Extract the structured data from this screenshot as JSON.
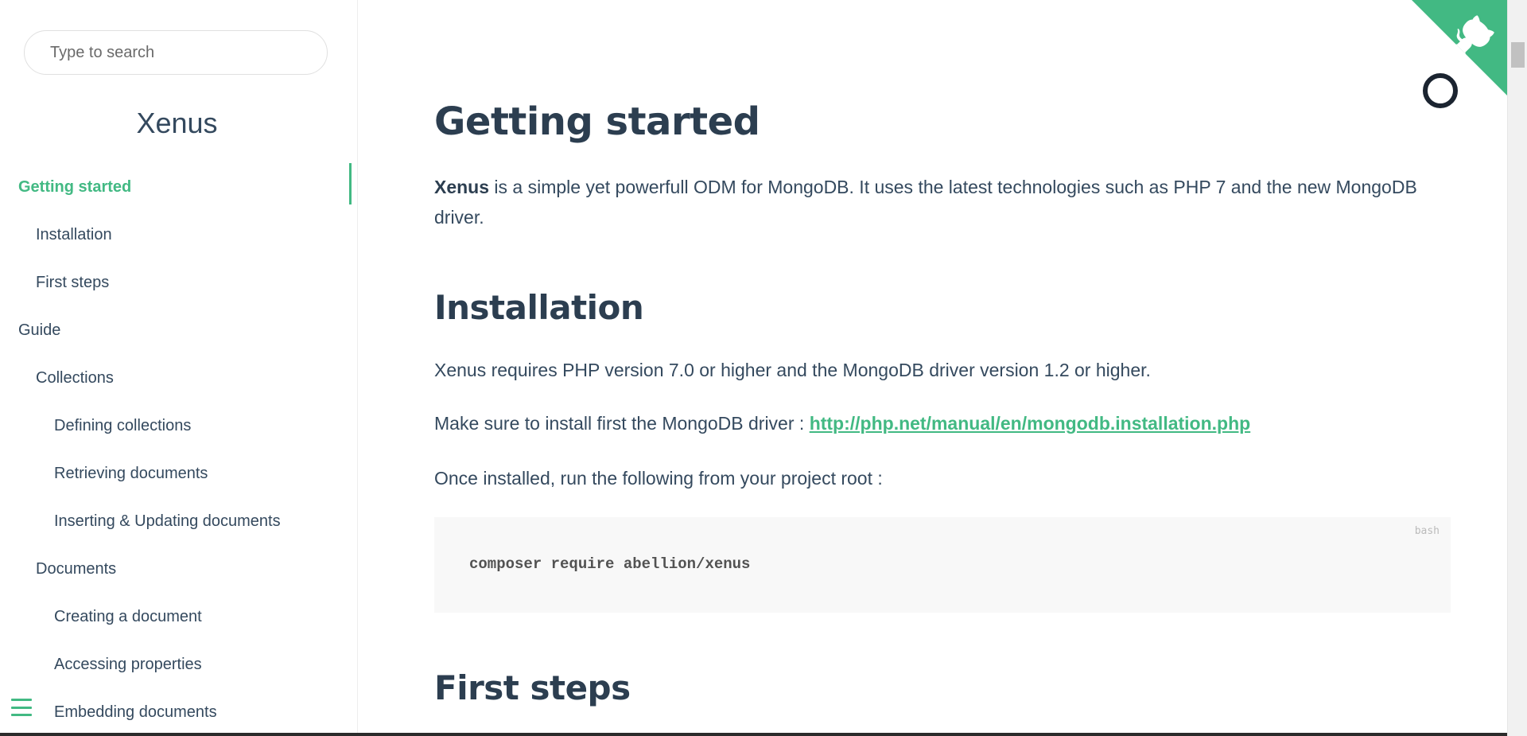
{
  "sidebar": {
    "search_placeholder": "Type to search",
    "app_name": "Xenus",
    "items": [
      {
        "label": "Getting started",
        "level": 0,
        "active": true
      },
      {
        "label": "Installation",
        "level": 1
      },
      {
        "label": "First steps",
        "level": 1
      },
      {
        "label": "Guide",
        "level": 0
      },
      {
        "label": "Collections",
        "level": 1
      },
      {
        "label": "Defining collections",
        "level": 2
      },
      {
        "label": "Retrieving documents",
        "level": 2
      },
      {
        "label": "Inserting & Updating documents",
        "level": 2
      },
      {
        "label": "Documents",
        "level": 1
      },
      {
        "label": "Creating a document",
        "level": 2
      },
      {
        "label": "Accessing properties",
        "level": 2
      },
      {
        "label": "Embedding documents",
        "level": 2
      }
    ]
  },
  "content": {
    "title": "Getting started",
    "intro_bold": "Xenus",
    "intro_rest": " is a simple yet powerfull ODM for MongoDB. It uses the latest technologies such as PHP 7 and the new MongoDB driver.",
    "installation_heading": "Installation",
    "requirements_text": "Xenus requires PHP version 7.0 or higher and the MongoDB driver version 1.2 or higher.",
    "driver_text": "Make sure to install first the MongoDB driver : ",
    "driver_link": "http://php.net/manual/en/mongodb.installation.php",
    "run_text": "Once installed, run the following from your project root :",
    "code_lang": "bash",
    "code": "composer require abellion/xenus",
    "first_steps_heading": "First steps"
  },
  "colors": {
    "accent": "#42b983",
    "text": "#34495e",
    "heading": "#2c3e50",
    "code_bg": "#f8f8f8"
  },
  "icons": {
    "github_corner": "github-octocat-icon",
    "menu": "hamburger-menu-icon",
    "loader": "loading-ring-icon"
  }
}
